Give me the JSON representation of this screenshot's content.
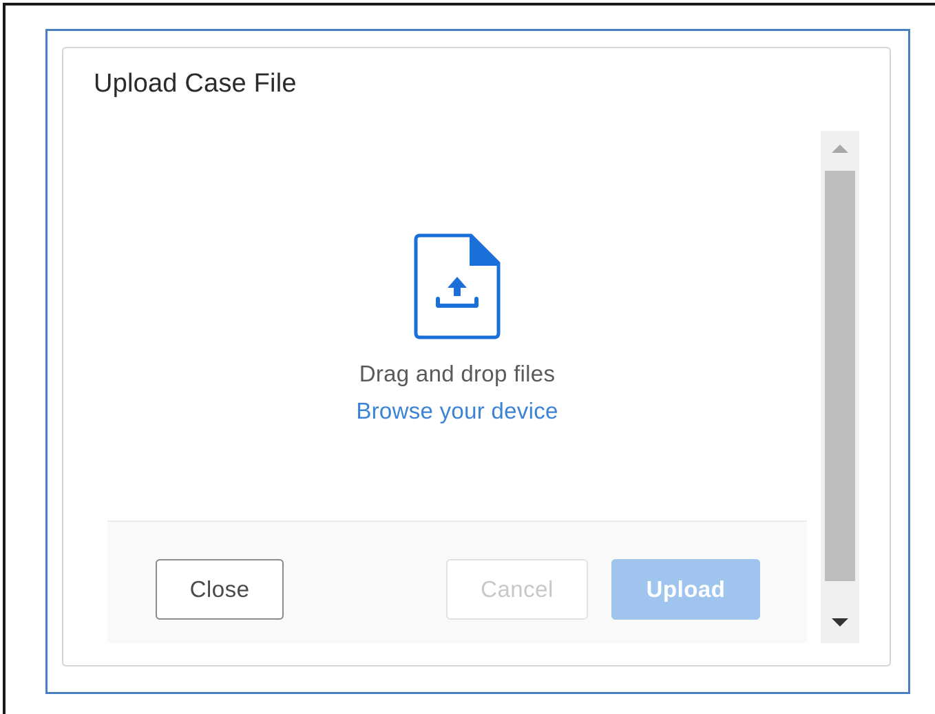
{
  "dialog": {
    "title": "Upload Case File"
  },
  "drop_zone": {
    "icon": "file-upload-icon",
    "instruction": "Drag and drop files",
    "browse_link": "Browse your device"
  },
  "footer": {
    "close_label": "Close",
    "cancel_label": "Cancel",
    "upload_label": "Upload"
  },
  "scrollbar": {
    "up_icon": "triangle-up-icon",
    "down_icon": "triangle-down-icon"
  },
  "colors": {
    "accent": "#1a6fd9",
    "link": "#3b83d6",
    "upload_disabled": "#9fc4ee",
    "outer_border": "#4a7fc1"
  }
}
